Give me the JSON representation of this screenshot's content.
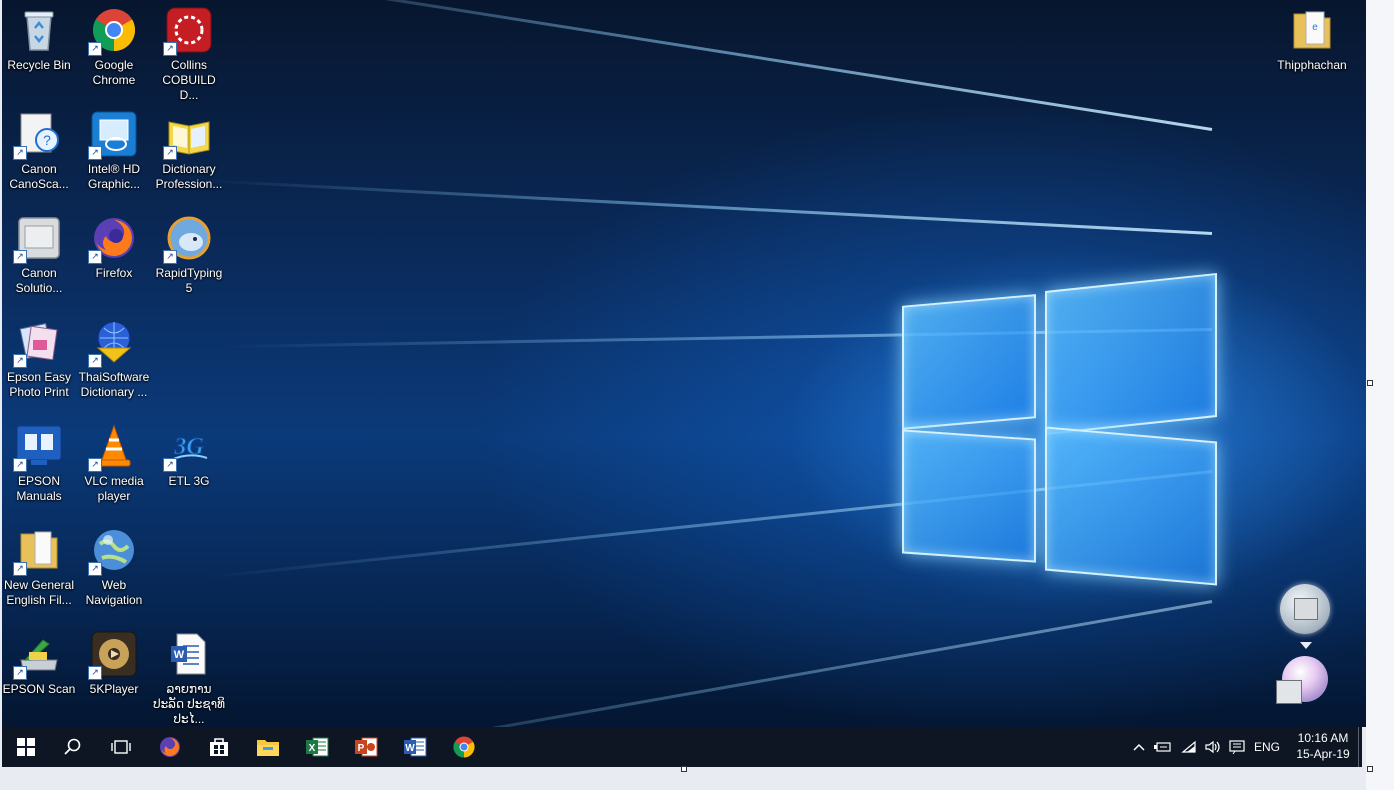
{
  "desktop_icons": [
    {
      "label": "Recycle Bin",
      "icon": "recycle-bin-icon",
      "shortcut": false
    },
    {
      "label": "Google Chrome",
      "icon": "chrome-icon",
      "shortcut": true
    },
    {
      "label": "Collins COBUILD D...",
      "icon": "collins-cobuild-icon",
      "shortcut": true
    },
    {
      "label": "Canon CanoSca...",
      "icon": "canon-canoscan-icon",
      "shortcut": true
    },
    {
      "label": "Intel® HD Graphic...",
      "icon": "intel-hd-graphics-icon",
      "shortcut": true
    },
    {
      "label": "Dictionary Profession...",
      "icon": "dictionary-professional-icon",
      "shortcut": true
    },
    {
      "label": "Canon Solutio...",
      "icon": "canon-solution-menu-icon",
      "shortcut": true
    },
    {
      "label": "Firefox",
      "icon": "firefox-icon",
      "shortcut": true
    },
    {
      "label": "RapidTyping 5",
      "icon": "rapidtyping-icon",
      "shortcut": true
    },
    {
      "label": "Epson Easy Photo Print",
      "icon": "epson-easy-photo-print-icon",
      "shortcut": true
    },
    {
      "label": "ThaiSoftware Dictionary ...",
      "icon": "thaisoftware-dictionary-icon",
      "shortcut": true
    },
    {
      "label": "EPSON Manuals",
      "icon": "epson-manuals-icon",
      "shortcut": true
    },
    {
      "label": "VLC media player",
      "icon": "vlc-icon",
      "shortcut": true
    },
    {
      "label": "ETL 3G",
      "icon": "etl-3g-icon",
      "shortcut": true
    },
    {
      "label": "New General English Fil...",
      "icon": "folder-icon",
      "shortcut": true
    },
    {
      "label": "Web Navigation",
      "icon": "web-navigation-icon",
      "shortcut": true
    },
    {
      "label": "EPSON Scan",
      "icon": "epson-scan-icon",
      "shortcut": true
    },
    {
      "label": "5KPlayer",
      "icon": "5kplayer-icon",
      "shortcut": true
    },
    {
      "label": "ລາຍການປະລັດ ປະຊາທິປະໄ...",
      "icon": "word-document-icon",
      "shortcut": false
    }
  ],
  "top_right_icon": {
    "label": "Thipphachan",
    "icon": "folder-icon"
  },
  "taskbar": {
    "apps": [
      {
        "name": "start-icon"
      },
      {
        "name": "search-icon"
      },
      {
        "name": "task-view-icon"
      },
      {
        "name": "firefox-icon"
      },
      {
        "name": "store-icon"
      },
      {
        "name": "file-explorer-icon"
      },
      {
        "name": "excel-icon"
      },
      {
        "name": "powerpoint-icon"
      },
      {
        "name": "word-icon"
      },
      {
        "name": "chrome-icon"
      }
    ],
    "tray": {
      "language": "ENG",
      "time": "10:16 AM",
      "date": "15-Apr-19"
    }
  },
  "colors": {
    "taskbar": "#0e1624",
    "accent": "#2a8cf0"
  }
}
